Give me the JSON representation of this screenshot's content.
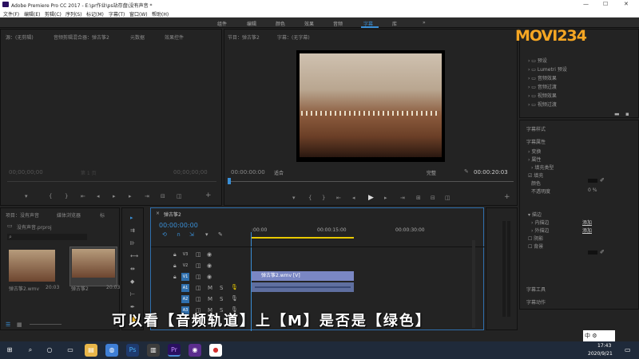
{
  "titlebar": {
    "title": "Adobe Premiere Pro CC 2017 - E:\\pr作业\\ps站存盘\\没有声音 *",
    "min": "—",
    "max": "☐",
    "close": "✕"
  },
  "menubar": {
    "items": [
      "文件(F)",
      "编辑(E)",
      "剪辑(C)",
      "序列(S)",
      "标记(M)",
      "字幕(T)",
      "窗口(W)",
      "帮助(H)"
    ]
  },
  "workspaces": {
    "items": [
      "组件",
      "编辑",
      "颜色",
      "效果",
      "音频",
      "字幕",
      "库"
    ],
    "more": "»"
  },
  "source_monitor": {
    "tabs": [
      "源：(无剪辑)",
      "音频剪辑混合器：弹古筝2",
      "元数据",
      "效果控件"
    ],
    "timecode_left": "00;00;00;00",
    "timecode_right": "00;00;00;00",
    "page_label": "第 1 页"
  },
  "program_monitor": {
    "tabs": [
      "节目：弹古筝2",
      "字幕：(无字幕)"
    ],
    "timecode": "00:00:00:00",
    "fit": "适合",
    "quality": "完整",
    "duration": "00:00:20:03"
  },
  "project_panel": {
    "tabs": [
      "项目：没有声音",
      "媒体浏览器",
      "标"
    ],
    "file": "没有声音.prproj",
    "clips": [
      {
        "name": "弹古筝2.wmv",
        "duration": "20:03"
      },
      {
        "name": "弹古筝2",
        "duration": "20:03"
      }
    ]
  },
  "timeline": {
    "tab": "弹古筝2",
    "timecode": "00:00:00:00",
    "ruler": [
      ":00:00",
      "00:00:15:00",
      "00:00:30:00"
    ],
    "tracks": [
      {
        "label": "V3",
        "active": false
      },
      {
        "label": "V2",
        "active": false
      },
      {
        "label": "V1",
        "active": true
      },
      {
        "label": "A1",
        "active": true
      },
      {
        "label": "A2",
        "active": true
      },
      {
        "label": "A3",
        "active": true
      }
    ],
    "clip_video": "弹古筝2.wmv [V]",
    "mute_label": "M",
    "solo_label": "S"
  },
  "effects_panel": {
    "items": [
      "预设",
      "Lumetri 预设",
      "音频效果",
      "音频过渡",
      "视频效果",
      "视频过渡"
    ]
  },
  "title_properties": {
    "header_styles": "字幕样式",
    "header_props": "字幕属性",
    "rows": [
      "变换",
      "属性",
      "填充",
      "描边",
      "内描边",
      "外描边",
      "阴影",
      "背景"
    ],
    "fill_sub": [
      "填充类型",
      "颜色",
      "不透明度"
    ],
    "add1": "添加",
    "add2": "添加",
    "percent": "0 %",
    "tools": "字幕工具",
    "actions": "字幕动作"
  },
  "subtitle": "可以看【音频轨道】上【M】是否是【绿色】",
  "watermark": "MOVI234",
  "taskbar": {
    "time": "17:43",
    "date": "2020/9/21",
    "ime": "中"
  },
  "colors": {
    "accent": "#3a8fd6",
    "panel_bg": "#232323",
    "clip_video": "#7a87c4",
    "active_track": "#2f6fad"
  }
}
